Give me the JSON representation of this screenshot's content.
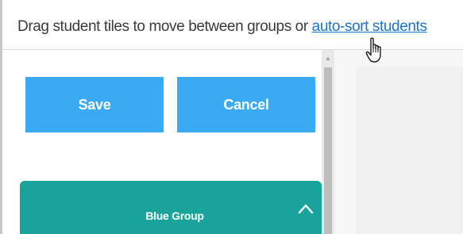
{
  "instruction": {
    "text": "Drag student tiles to move between groups or ",
    "link_label": "auto-sort students"
  },
  "buttons": {
    "save_label": "Save",
    "cancel_label": "Cancel"
  },
  "group": {
    "name": "Blue Group",
    "icon": "chevron-up-icon"
  },
  "colors": {
    "button_blue": "#3aaaf2",
    "group_teal": "#1aa39a",
    "link_blue": "#1f73c7"
  }
}
